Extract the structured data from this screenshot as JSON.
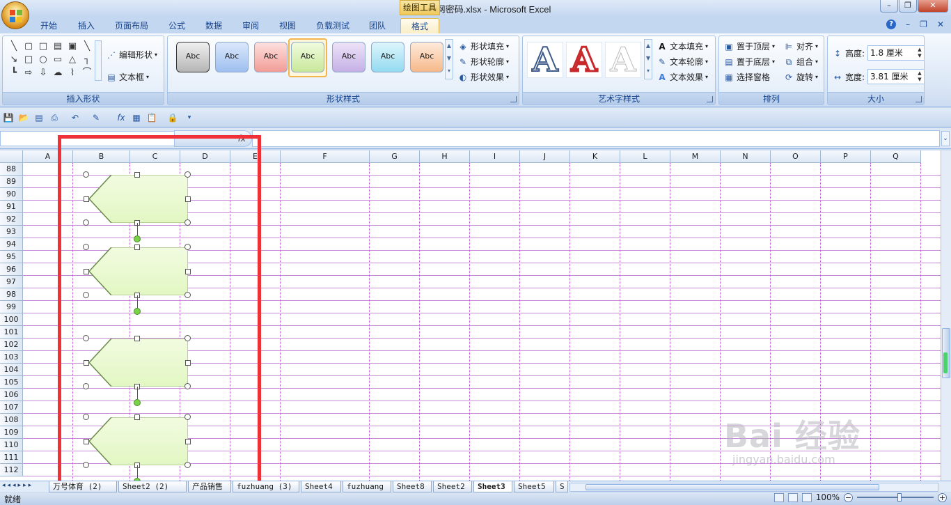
{
  "window": {
    "title": "两小无猜网密码.xlsx - Microsoft Excel",
    "tool_tab_title": "绘图工具"
  },
  "tabs": [
    {
      "label": "开始"
    },
    {
      "label": "插入"
    },
    {
      "label": "页面布局"
    },
    {
      "label": "公式"
    },
    {
      "label": "数据"
    },
    {
      "label": "审阅"
    },
    {
      "label": "视图"
    },
    {
      "label": "负载测试"
    },
    {
      "label": "团队"
    },
    {
      "label": "格式"
    }
  ],
  "ribbon": {
    "insert_shapes": {
      "edit_shape": "编辑形状",
      "text_box": "文本框",
      "label": "插入形状"
    },
    "shape_styles": {
      "sample": "Abc",
      "fill": "形状填充",
      "outline": "形状轮廓",
      "effects": "形状效果",
      "label": "形状样式"
    },
    "wordart": {
      "letter": "A",
      "text_fill": "文本填充",
      "text_outline": "文本轮廓",
      "text_effects": "文本效果",
      "label": "艺术字样式"
    },
    "arrange": {
      "bring_front": "置于顶层",
      "send_back": "置于底层",
      "selection_pane": "选择窗格",
      "align": "对齐",
      "group": "组合",
      "rotate": "旋转",
      "label": "排列"
    },
    "size": {
      "height_label": "高度:",
      "height_value": "1.8 厘米",
      "width_label": "宽度:",
      "width_value": "3.81 厘米",
      "label": "大小"
    }
  },
  "formula_bar": {
    "fx": "fx"
  },
  "columns": [
    "A",
    "B",
    "C",
    "D",
    "E",
    "F",
    "G",
    "H",
    "I",
    "J",
    "K",
    "L",
    "M",
    "N",
    "O",
    "P",
    "Q"
  ],
  "rows": [
    "88",
    "89",
    "90",
    "91",
    "92",
    "93",
    "94",
    "95",
    "96",
    "97",
    "98",
    "99",
    "100",
    "101",
    "102",
    "103",
    "104",
    "105",
    "106",
    "107",
    "108",
    "109",
    "110",
    "111",
    "112"
  ],
  "sheets": [
    "万号体育 (2)",
    "Sheet2 (2)",
    "产品销售",
    "fuzhuang (3)",
    "Sheet4",
    "fuzhuang",
    "Sheet8",
    "Sheet2",
    "Sheet3",
    "Sheet5",
    "S"
  ],
  "active_sheet": "Sheet3",
  "status": {
    "left": "就绪",
    "zoom": "100%"
  },
  "watermark": {
    "main": "Bai 经验",
    "sub": "jingyan.baidu.com"
  },
  "colors": {
    "highlight_box": "#ee3237",
    "shape_fill": "#e2f7c3"
  }
}
